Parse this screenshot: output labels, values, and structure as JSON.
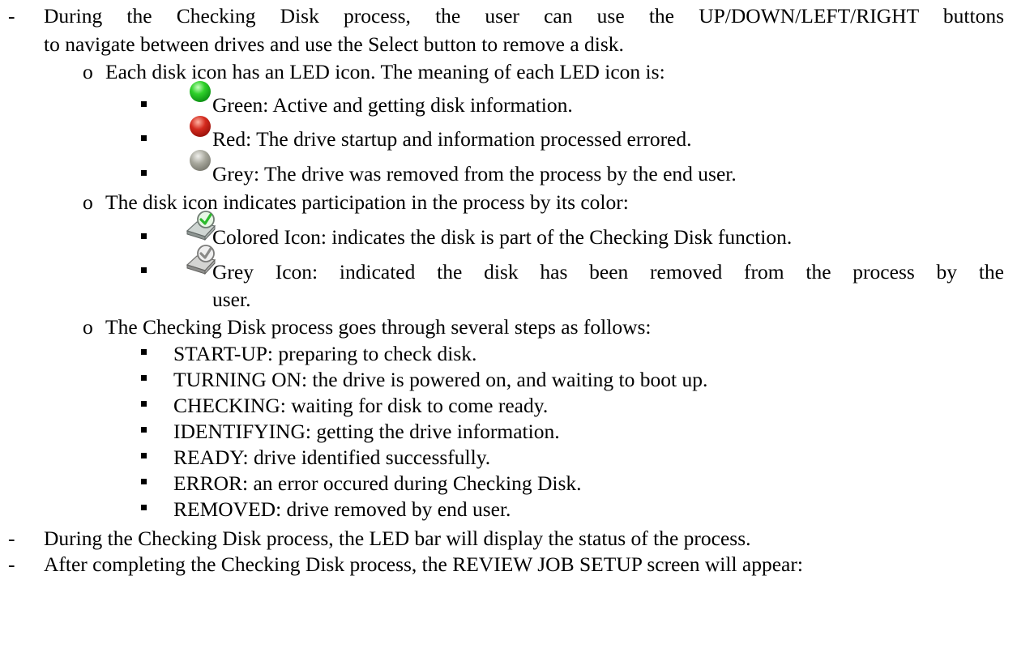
{
  "paragraphs": [
    {
      "line1": "During the Checking Disk process, the user can use the UP/DOWN/LEFT/RIGHT buttons",
      "line2": "to navigate between drives and use the Select button to remove a disk."
    }
  ],
  "led_section": {
    "intro": "Each disk icon has an LED icon. The meaning of each LED icon is:",
    "items": [
      {
        "icon": "green-led-icon",
        "color": "#1fbf1f",
        "text": "Green: Active and getting disk information."
      },
      {
        "icon": "red-led-icon",
        "color": "#c01a10",
        "text": "Red: The drive startup and information processed errored."
      },
      {
        "icon": "grey-led-icon",
        "color": "#8f8f85",
        "text": "Grey: The drive was removed from the process by the end user."
      }
    ]
  },
  "disk_section": {
    "intro": "The disk icon indicates participation in the process by its color:",
    "items": [
      {
        "icon": "colored-disk-icon",
        "text": "Colored Icon: indicates the disk is part of the Checking Disk function."
      },
      {
        "icon": "grey-disk-icon",
        "text_line1": "Grey Icon: indicated the disk has been removed from the process by the",
        "text_line2": "user."
      }
    ]
  },
  "steps_section": {
    "intro": "The Checking Disk process goes through several steps as follows:",
    "steps": [
      "START-UP:  preparing to check disk.",
      "TURNING ON: the drive is powered on, and waiting to boot up.",
      "CHECKING: waiting for disk to come ready.",
      "IDENTIFYING: getting the drive information.",
      "READY: drive identified successfully.",
      "ERROR: an error occured during Checking Disk.",
      "REMOVED: drive removed by end user."
    ]
  },
  "closing": [
    "During the Checking Disk process, the LED bar will display the status of the process.",
    "After completing the Checking Disk process, the REVIEW JOB SETUP screen will appear:"
  ],
  "markers": {
    "dash": "-",
    "sub": "o"
  }
}
